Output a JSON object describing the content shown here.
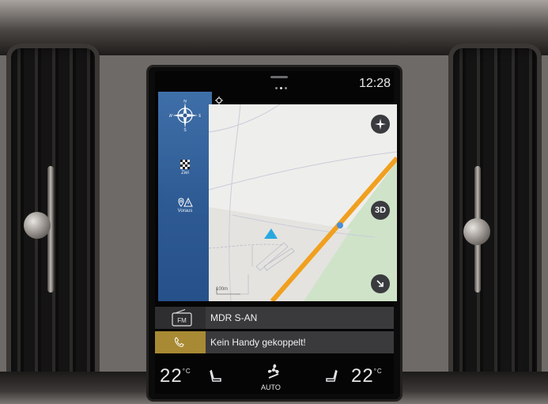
{
  "status_bar": {
    "time": "12:28"
  },
  "sidebar": {
    "compass_letters": {
      "n": "N",
      "s": "S",
      "e": "E",
      "w": "W"
    },
    "items": [
      {
        "label": "Ziel",
        "icon": "checkered-flag-icon"
      },
      {
        "label": "Voraus",
        "icon": "pin-warning-icon"
      }
    ]
  },
  "map": {
    "view_mode_label": "3D",
    "scale_label": "100m",
    "road_color": "#f0a01e",
    "green_area_color": "#cfe3c9",
    "position_marker_color": "#29a8e0"
  },
  "radio": {
    "band": "FM",
    "station": "MDR S-AN"
  },
  "phone": {
    "status": "Kein Handy gekoppelt!"
  },
  "climate": {
    "driver_temp": "22",
    "passenger_temp": "22",
    "unit": "°C",
    "fan_mode": "AUTO"
  }
}
